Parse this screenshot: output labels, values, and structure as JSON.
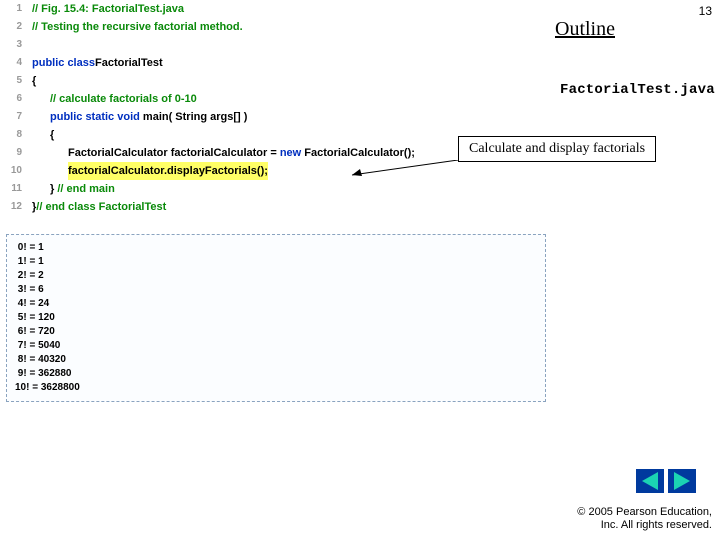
{
  "slide_number": "13",
  "outline_label": "Outline",
  "filename": "FactorialTest.java",
  "callout": "Calculate and display factorials",
  "copyright_line1": "© 2005 Pearson Education,",
  "copyright_line2": "Inc.  All rights reserved.",
  "code": {
    "l1_comment": "// Fig. 15.4: FactorialTest.java",
    "l2_comment": "// Testing the recursive factorial method.",
    "l4_kw": "public class",
    "l4_name": " FactorialTest",
    "l5_brace": "{",
    "l6_comment": "// calculate factorials of 0-10",
    "l7_kw": "public static void",
    "l7_rest": " main( String args[] )",
    "l8_brace": "{",
    "l9_a": "FactorialCalculator factorialCalculator = ",
    "l9_kw": "new",
    "l9_b": " FactorialCalculator();",
    "l10_call": "factorialCalculator.displayFactorials();",
    "l11_brace": "} ",
    "l11_comment": "// end main",
    "l12_brace": "} ",
    "l12_comment": "// end class FactorialTest"
  },
  "line_numbers": [
    "1",
    "2",
    "3",
    "4",
    "5",
    "6",
    "7",
    "8",
    "9",
    "10",
    "11",
    "12"
  ],
  "output": [
    " 0! = 1",
    " 1! = 1",
    " 2! = 2",
    " 3! = 6",
    " 4! = 24",
    " 5! = 120",
    " 6! = 720",
    " 7! = 5040",
    " 8! = 40320",
    " 9! = 362880",
    "10! = 3628800"
  ]
}
